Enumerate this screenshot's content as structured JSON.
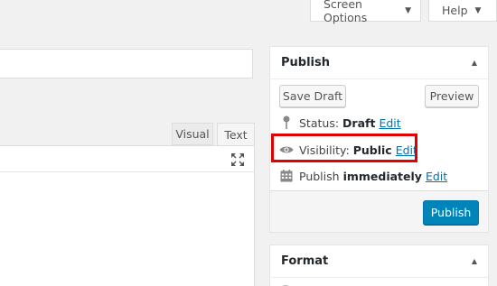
{
  "screen_meta": {
    "screen_options_label": "Screen Options",
    "help_label": "Help"
  },
  "editor": {
    "tab_visual": "Visual",
    "tab_text": "Text"
  },
  "publish_box": {
    "title": "Publish",
    "save_draft_label": "Save Draft",
    "preview_label": "Preview",
    "status_label": "Status:",
    "status_value": "Draft",
    "status_edit": "Edit",
    "visibility_label": "Visibility:",
    "visibility_value": "Public",
    "visibility_edit": "Edit",
    "schedule_label": "Publish",
    "schedule_value": "immediately",
    "schedule_edit": "Edit",
    "publish_button_label": "Publish"
  },
  "format_box": {
    "title": "Format"
  },
  "colors": {
    "highlight": "#e00000",
    "publish_button": "#0085ba",
    "link": "#0073aa"
  }
}
